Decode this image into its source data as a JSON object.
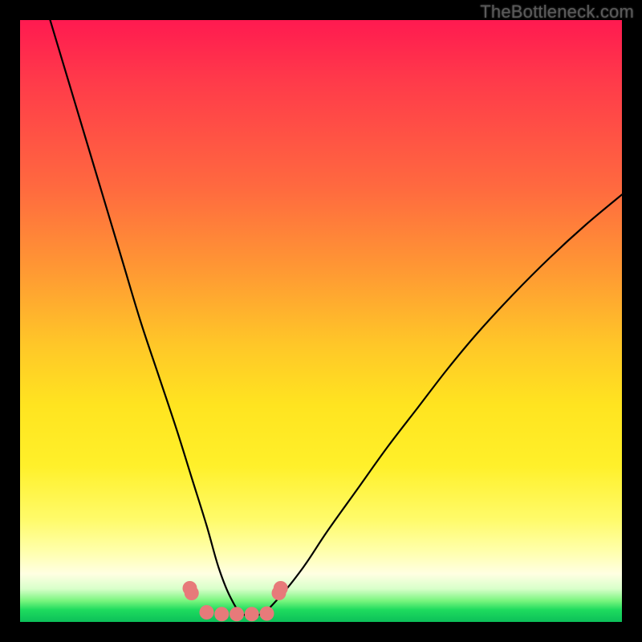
{
  "attribution": "TheBottleneck.com",
  "colors": {
    "frame": "#000000",
    "curve_stroke": "#000000",
    "marker_fill": "#e77a7a",
    "marker_stroke": "#c45a5a",
    "gradient_top": "#ff1a50",
    "gradient_bottom": "#0cbf59"
  },
  "chart_data": {
    "type": "line",
    "title": "",
    "xlabel": "",
    "ylabel": "",
    "xlim": [
      0,
      100
    ],
    "ylim": [
      0,
      100
    ],
    "x": [
      5,
      8,
      11,
      14,
      17,
      20,
      23,
      26,
      28.5,
      31,
      33,
      35,
      37,
      40,
      43,
      47,
      51,
      56,
      61,
      66,
      71,
      76,
      82,
      88,
      94,
      100
    ],
    "values": [
      100,
      90,
      80,
      70,
      60,
      50,
      41,
      32,
      24,
      16,
      9,
      4,
      1.3,
      1.3,
      4,
      9,
      15,
      22,
      29,
      35.5,
      42,
      48,
      54.5,
      60.5,
      66,
      71
    ],
    "markers": {
      "x": [
        28.2,
        28.5,
        31.0,
        33.5,
        36.0,
        38.5,
        41.0,
        43.0,
        43.3
      ],
      "y": [
        5.6,
        4.8,
        1.6,
        1.3,
        1.3,
        1.3,
        1.4,
        4.8,
        5.6
      ]
    },
    "annotations": []
  }
}
